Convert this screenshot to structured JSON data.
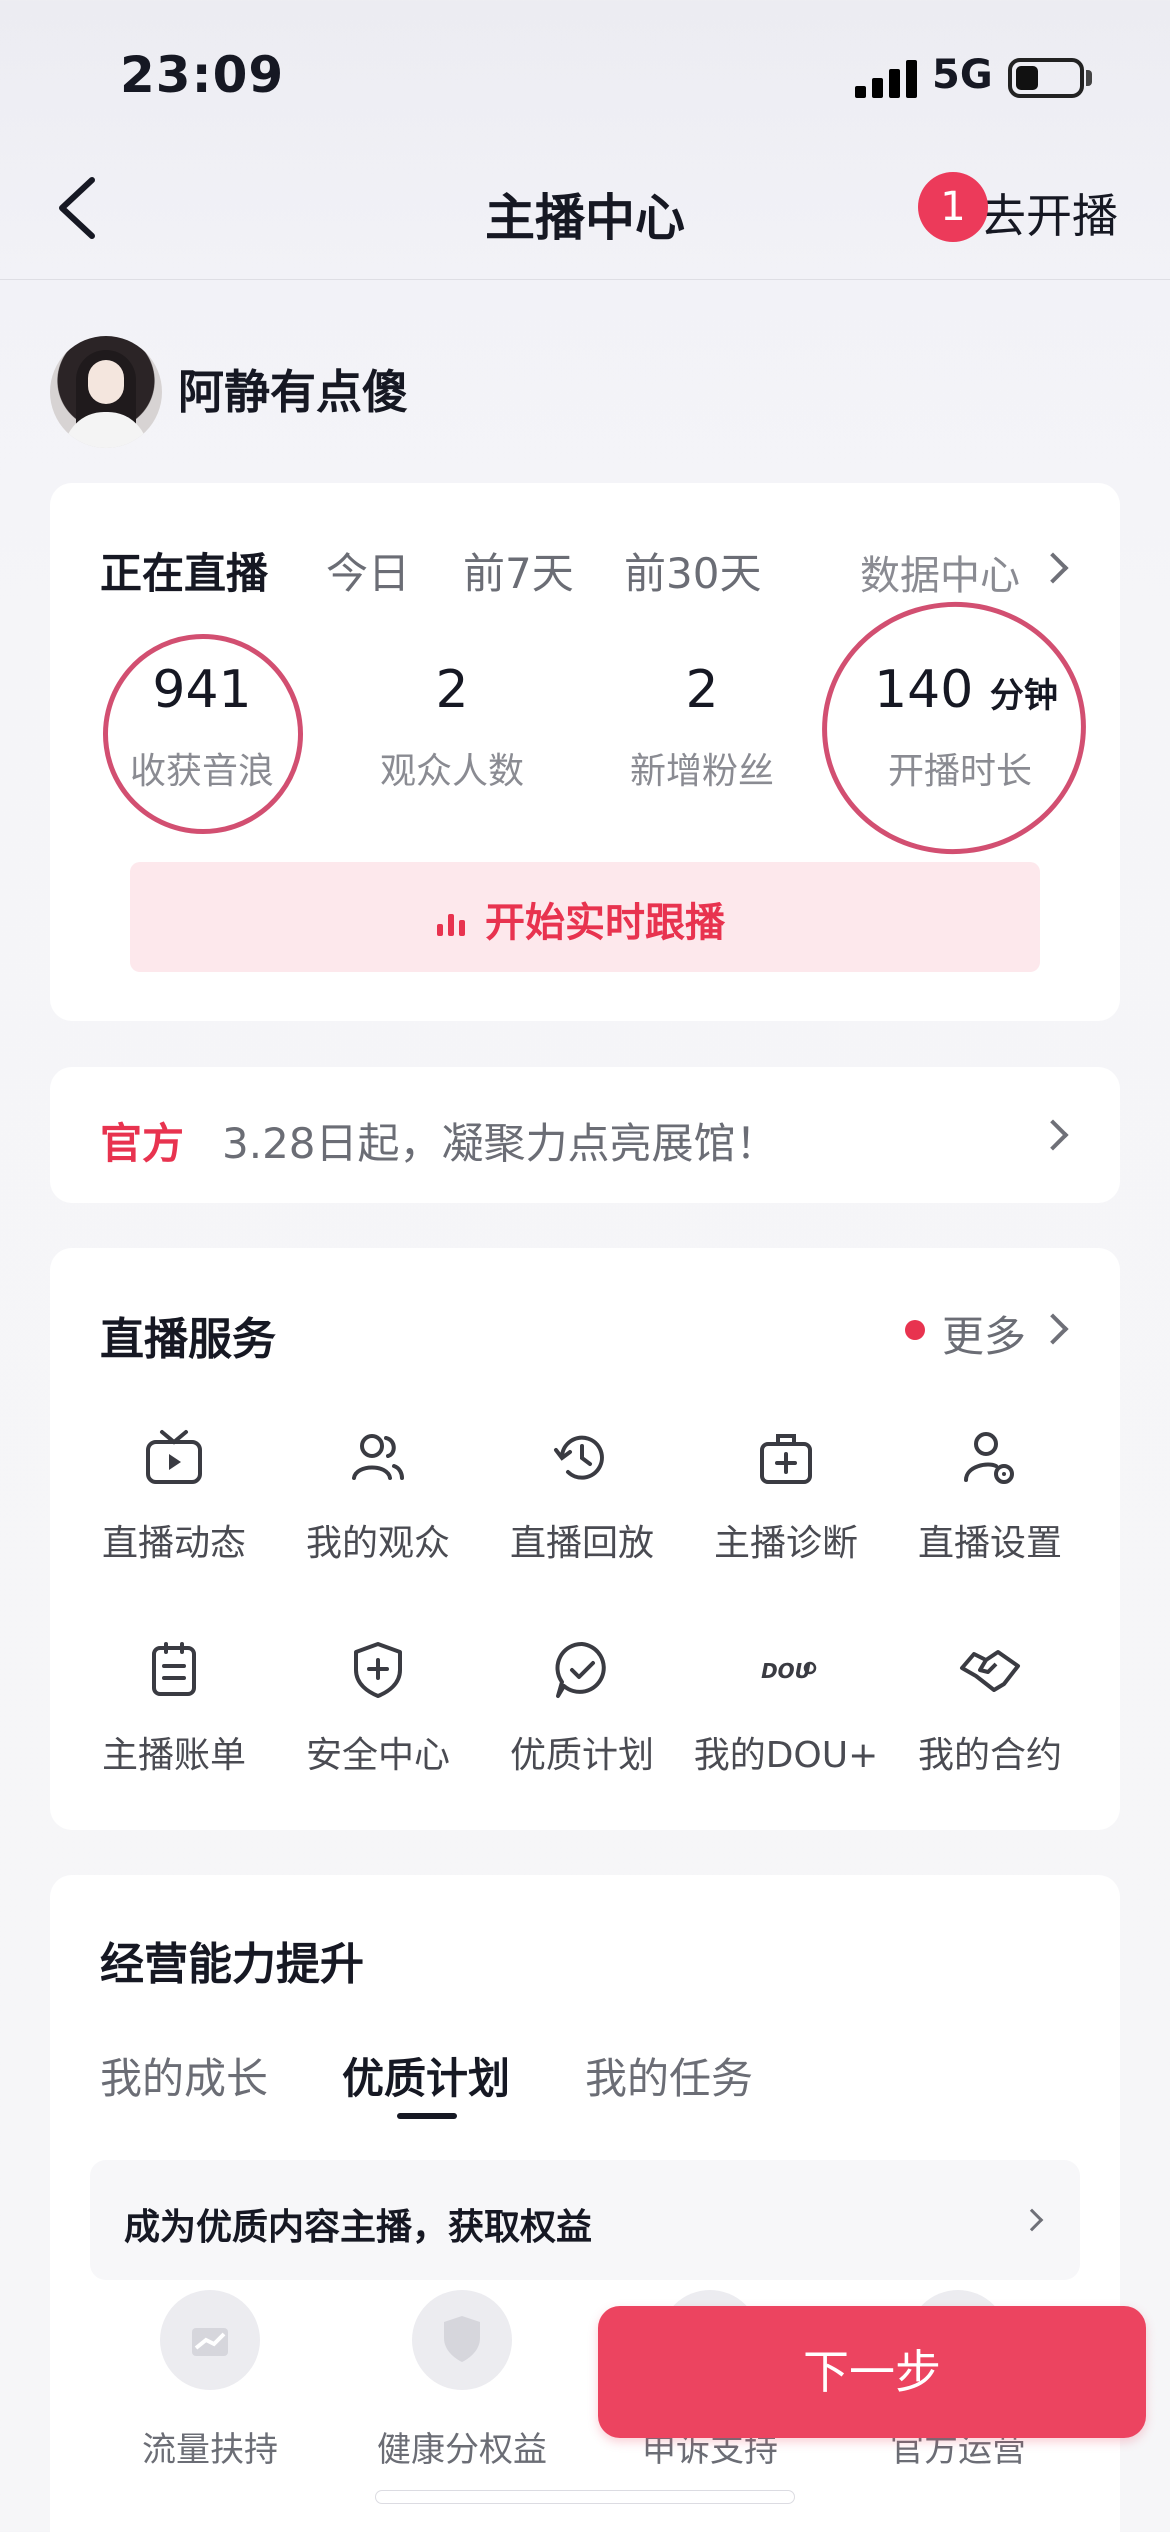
{
  "status": {
    "time": "23:09",
    "network": "5G"
  },
  "nav": {
    "title": "主播中心",
    "badge": "1",
    "action": "去开播"
  },
  "profile": {
    "name": "阿静有点傻"
  },
  "stats": {
    "tabs": [
      "正在直播",
      "今日",
      "前7天",
      "前30天"
    ],
    "data_center": "数据中心",
    "items": [
      {
        "value": "941",
        "label": "收获音浪"
      },
      {
        "value": "2",
        "label": "观众人数"
      },
      {
        "value": "2",
        "label": "新增粉丝"
      },
      {
        "value": "140",
        "unit": "分钟",
        "label": "开播时长"
      }
    ],
    "follow_button": "开始实时跟播"
  },
  "official": {
    "tag": "官方",
    "text": "3.28日起，凝聚力点亮展馆！"
  },
  "services": {
    "title": "直播服务",
    "more": "更多",
    "items": [
      {
        "label": "直播动态",
        "icon": "tv-icon"
      },
      {
        "label": "我的观众",
        "icon": "audience-icon"
      },
      {
        "label": "直播回放",
        "icon": "replay-icon"
      },
      {
        "label": "主播诊断",
        "icon": "medical-kit-icon"
      },
      {
        "label": "直播设置",
        "icon": "user-settings-icon"
      },
      {
        "label": "主播账单",
        "icon": "bill-icon"
      },
      {
        "label": "安全中心",
        "icon": "shield-plus-icon"
      },
      {
        "label": "优质计划",
        "icon": "check-bubble-icon"
      },
      {
        "label": "我的DOU+",
        "icon": "dou-plus-icon"
      },
      {
        "label": "我的合约",
        "icon": "handshake-icon"
      }
    ]
  },
  "growth": {
    "title": "经营能力提升",
    "tabs": [
      "我的成长",
      "优质计划",
      "我的任务"
    ],
    "quality_text": "成为优质内容主播，获取权益",
    "benefits": [
      {
        "label": "流量扶持"
      },
      {
        "label": "健康分权益"
      },
      {
        "label": "申诉支持"
      },
      {
        "label": "官方运营"
      }
    ]
  },
  "next_button": "下一步",
  "colors": {
    "accent": "#e8334f",
    "button": "#ec4460",
    "annotation": "#d24f71"
  }
}
